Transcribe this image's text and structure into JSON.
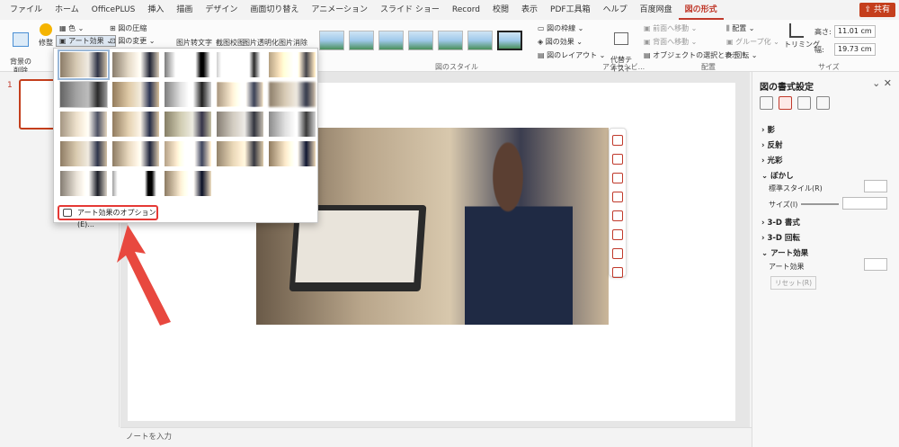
{
  "tabs": [
    "ファイル",
    "ホーム",
    "OfficePLUS",
    "挿入",
    "描画",
    "デザイン",
    "画面切り替え",
    "アニメーション",
    "スライド ショー",
    "Record",
    "校閲",
    "表示",
    "PDF工具箱",
    "ヘルプ",
    "百度网盘",
    "図の形式"
  ],
  "active_tab": "図の形式",
  "share_label": "共有",
  "ribbon": {
    "remove_bg": "背景の\n削除",
    "corrections": "修整",
    "color": "色",
    "art_effects": "アート効果",
    "compress": "図の圧縮",
    "change_picture": "図の変更",
    "img_tools": [
      "图片转文字",
      "截图校图",
      "图片透明化",
      "图片消除"
    ],
    "pic_styles_label": "図のスタイル",
    "pic_border": "図の枠線",
    "pic_effects": "図の効果",
    "pic_layout": "図のレイアウト",
    "alt_text": "代替テ\nキスト",
    "accessibility_label": "アクセシビ...",
    "bring_forward": "前面へ移動",
    "send_backward": "背面へ移動",
    "selection_pane": "オブジェクトの選択と表示",
    "align": "配置",
    "group": "グループ化",
    "rotate": "回転",
    "arrange_label": "配置",
    "crop": "トリミング",
    "height_label": "高さ:",
    "height_value": "11.01 cm",
    "width_label": "幅:",
    "width_value": "19.73 cm",
    "size_label": "サイズ"
  },
  "slide_number": "1",
  "notes_placeholder": "ノートを入力",
  "dropdown": {
    "option_label": "アート効果のオプション(E)..."
  },
  "format_pane": {
    "title": "図の書式設定",
    "sections": [
      "影",
      "反射",
      "光彩",
      "ぼかし",
      "3-D 書式",
      "3-D 回転",
      "アート効果"
    ],
    "soft_edge_preset_label": "標準スタイル(R)",
    "soft_edge_size_label": "サイズ(I)",
    "art_effect_label": "アート効果",
    "reset_label": "リセット(R)"
  },
  "colors": {
    "accent": "#c0392b",
    "highlight_box": "#e53935"
  }
}
